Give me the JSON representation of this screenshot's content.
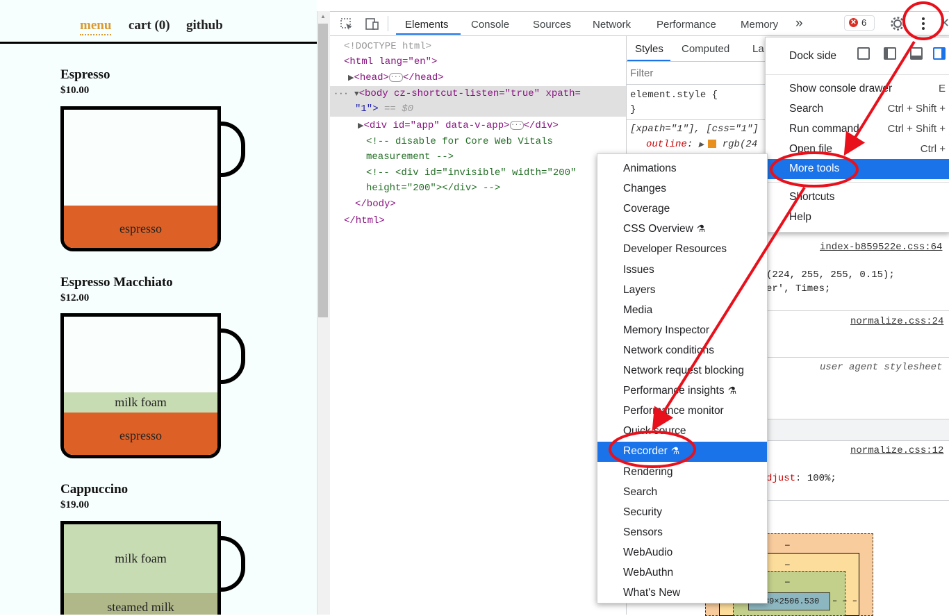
{
  "page": {
    "nav": {
      "menu": "menu",
      "cart": "cart (0)",
      "github": "github"
    },
    "coffees": [
      {
        "name": "Espresso",
        "price": "$10.00",
        "layers": [
          "espresso"
        ]
      },
      {
        "name": "Espresso Macchiato",
        "price": "$12.00",
        "layers": [
          "milk foam",
          "espresso"
        ]
      },
      {
        "name": "Cappuccino",
        "price": "$19.00",
        "layers": [
          "milk foam",
          "steamed milk"
        ]
      }
    ]
  },
  "devtools": {
    "tabs": [
      "Elements",
      "Console",
      "Sources",
      "Network",
      "Performance",
      "Memory"
    ],
    "more_tabs": "»",
    "error_count": "6",
    "elements": {
      "doctype": "<!DOCTYPE html>",
      "html_open": "<html lang=\"en\">",
      "head": "<head>",
      "head_close": "</head>",
      "body_open_1": "<body cz-shortcut-listen=\"true\" xpath=",
      "body_open_2": "\"1\">",
      "body_eq": "== $0",
      "div_app": "<div id=\"app\" data-v-app>",
      "div_close": "</div>",
      "comment1_a": "<!-- disable for Core Web Vitals",
      "comment1_b": "measurement -->",
      "comment2_a": "<!-- <div id=\"invisible\" width=\"200\"",
      "comment2_b": "height=\"200\"></div> -->",
      "body_close": "</body>",
      "html_close": "</html>"
    },
    "styles": {
      "tabs": [
        "Styles",
        "Computed",
        "La"
      ],
      "filter_placeholder": "Filter",
      "element_style": "element.style {",
      "close_brace": "}",
      "rule1": "[xpath=\"1\"], [css=\"1\"]",
      "outline_prop": "outline",
      "outline_val": "rgb(24",
      "link1": "index-b859522e.css:64",
      "bg_line": "(224, 255, 255, 0.15);",
      "font_line": "er', Times;",
      "link2": "normalize.css:24",
      "ua_label": "user agent stylesheet",
      "link3": "normalize.css:12",
      "adjust_prop": "djust",
      "adjust_val": "100%;",
      "box_dash1": "–",
      "box_dash2": "–",
      "box_padding_label": "g",
      "box_dash3": "–",
      "box_content": "889×2506.530",
      "box_right": "–  –  –"
    },
    "main_menu": {
      "dock_side": "Dock side",
      "items": [
        {
          "label": "Show console drawer",
          "shortcut": "E"
        },
        {
          "label": "Search",
          "shortcut": "Ctrl + Shift +"
        },
        {
          "label": "Run command",
          "shortcut": "Ctrl + Shift +"
        },
        {
          "label": "Open file",
          "shortcut": "Ctrl +"
        },
        {
          "label": "More tools",
          "shortcut": ""
        },
        {
          "label": "Shortcuts",
          "shortcut": ""
        },
        {
          "label": "Help",
          "shortcut": ""
        }
      ]
    },
    "more_tools": [
      {
        "label": "Animations",
        "flask": false
      },
      {
        "label": "Changes",
        "flask": false
      },
      {
        "label": "Coverage",
        "flask": false
      },
      {
        "label": "CSS Overview",
        "flask": true
      },
      {
        "label": "Developer Resources",
        "flask": false
      },
      {
        "label": "Issues",
        "flask": false
      },
      {
        "label": "Layers",
        "flask": false
      },
      {
        "label": "Media",
        "flask": false
      },
      {
        "label": "Memory Inspector",
        "flask": false
      },
      {
        "label": "Network conditions",
        "flask": false
      },
      {
        "label": "Network request blocking",
        "flask": false
      },
      {
        "label": "Performance insights",
        "flask": true
      },
      {
        "label": "Performance monitor",
        "flask": false
      },
      {
        "label": "Quick source",
        "flask": false
      },
      {
        "label": "Recorder",
        "flask": true,
        "highlighted": true
      },
      {
        "label": "Rendering",
        "flask": false
      },
      {
        "label": "Search",
        "flask": false
      },
      {
        "label": "Security",
        "flask": false
      },
      {
        "label": "Sensors",
        "flask": false
      },
      {
        "label": "WebAudio",
        "flask": false
      },
      {
        "label": "WebAuthn",
        "flask": false
      },
      {
        "label": "What's New",
        "flask": false
      }
    ]
  },
  "colors": {
    "accent": "#1a73e8",
    "annotation": "#e8101b",
    "espresso": "#dd6126",
    "foam": "#c8dcb4",
    "steamed": "#b0b88a",
    "nav_active": "#d99a31"
  }
}
